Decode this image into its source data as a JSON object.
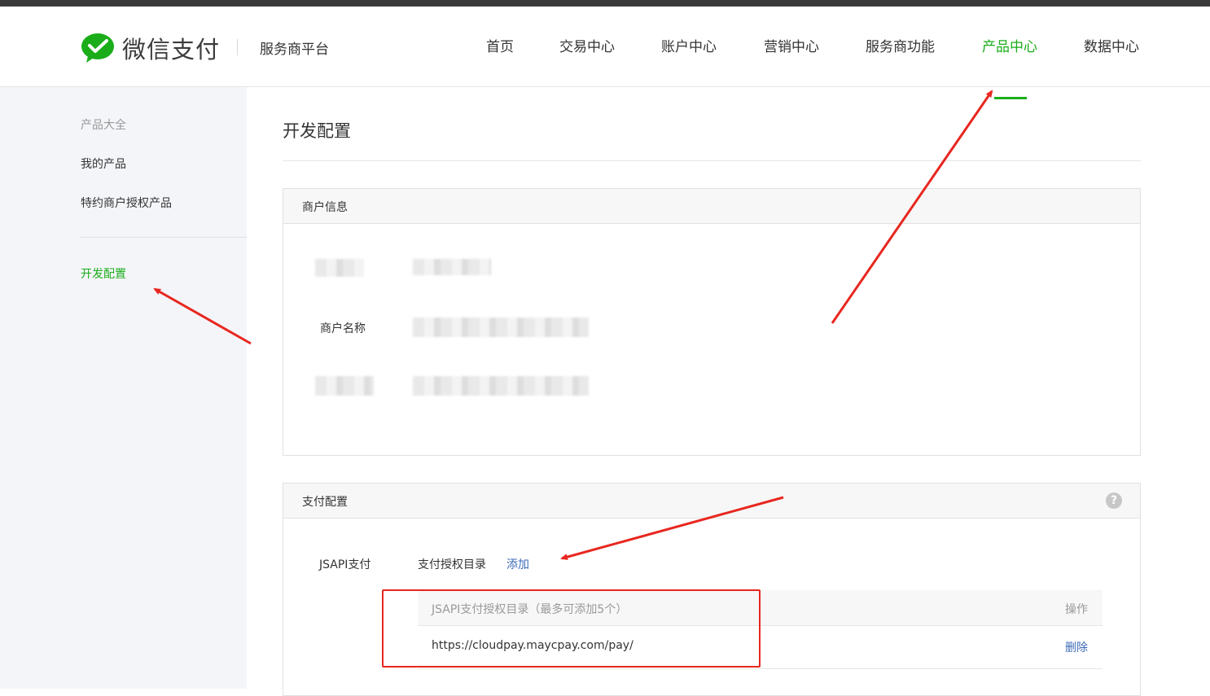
{
  "brand": {
    "name": "微信支付",
    "platform": "服务商平台",
    "color": "#1aad19"
  },
  "nav": {
    "items": [
      {
        "label": "首页"
      },
      {
        "label": "交易中心"
      },
      {
        "label": "账户中心"
      },
      {
        "label": "营销中心"
      },
      {
        "label": "服务商功能"
      },
      {
        "label": "产品中心",
        "active": true
      },
      {
        "label": "数据中心"
      }
    ]
  },
  "sidebar": {
    "section_title": "产品大全",
    "items": [
      {
        "label": "我的产品"
      },
      {
        "label": "特约商户授权产品"
      },
      {
        "label": "开发配置",
        "active": true
      }
    ]
  },
  "page": {
    "title": "开发配置"
  },
  "merchant_info": {
    "header": "商户信息",
    "name_label": "商户名称"
  },
  "payment_config": {
    "header": "支付配置",
    "help_icon": "question-circle-icon",
    "jsapi_label": "JSAPI支付",
    "dir_label": "支付授权目录",
    "add_link": "添加",
    "table": {
      "col_dir": "JSAPI支付授权目录（最多可添加5个）",
      "col_action": "操作",
      "rows": [
        {
          "url": "https://cloudpay.maycpay.com/pay/",
          "action": "删除"
        }
      ]
    }
  },
  "colors": {
    "accent": "#1aad19",
    "link": "#3e6bb8",
    "annotation": "#e8271f"
  }
}
